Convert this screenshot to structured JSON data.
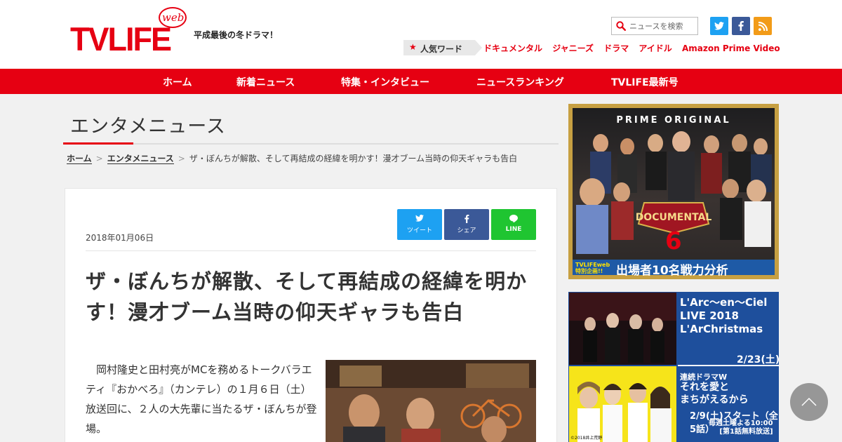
{
  "header": {
    "logo_text": "TVLIFE",
    "logo_web": "web",
    "tagline": "平成最後の冬ドラマ！",
    "search_placeholder": "ニュースを検索",
    "social": [
      "twitter-icon",
      "facebook-icon",
      "rss-icon"
    ],
    "popular_label": "人気ワード",
    "popular_words": [
      "ドキュメンタル",
      "ジャニーズ",
      "ドラマ",
      "アイドル",
      "Amazon Prime Video"
    ]
  },
  "nav": {
    "items": [
      "ホーム",
      "新着ニュース",
      "特集・インタビュー",
      "ニュースランキング",
      "TVLIFE最新号"
    ]
  },
  "section": {
    "title": "エンタメニュース"
  },
  "breadcrumb": {
    "home": "ホーム",
    "category": "エンタメニュース",
    "current": "ザ・ぼんちが解散、そして再結成の経緯を明かす！漫才ブーム当時の仰天ギャラも告白",
    "separator": ">"
  },
  "article": {
    "date": "2018年01月06日",
    "share": {
      "twitter": "ツイート",
      "facebook": "シェア",
      "line": "LINE"
    },
    "headline": "ザ・ぼんちが解散、そして再結成の経緯を明かす！漫才ブーム当時の仰天ギャラも告白",
    "body": "岡村隆史と田村亮がMCを務めるトークバラエティ『おかべろ』（カンテレ）の１月６日（土）放送回に、２人の大先輩に当たるザ・ぼんちが登場。"
  },
  "sidebar": {
    "ad1": {
      "top": "PRIME ORIGINAL",
      "number": "6",
      "small": "TVLIFEweb 特別企画!!",
      "big": "出場者10名戦力分析"
    },
    "ad2": {
      "title1": "L'Arc〜en〜Ciel LIVE 2018 L'ArChristmas",
      "title1_lines": [
        "L'Arc〜en〜Ciel",
        "LIVE 2018",
        "L'ArChristmas"
      ],
      "date1": "2/23(土)",
      "title2_small": "連続ドラマW",
      "title2_lines": [
        "それを愛と",
        "まちがえるから"
      ],
      "date2": "2/9(土)スタート（全5話）",
      "date2_sub_lines": [
        "毎週土曜よる10:00",
        "[第1話無料放送]"
      ],
      "copyright": "©2018井上荒野"
    }
  },
  "colors": {
    "brand_red": "#e60012",
    "twitter": "#1da1f2",
    "facebook": "#3b5998",
    "line": "#1fc531",
    "rss": "#f29b18"
  }
}
